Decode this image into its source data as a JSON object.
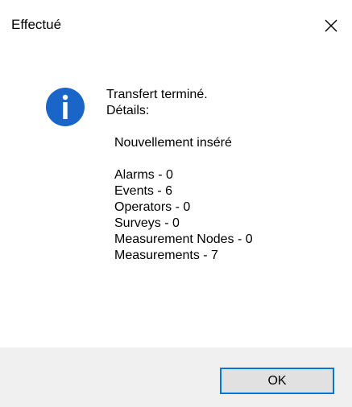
{
  "window": {
    "title": "Effectué",
    "close_icon": "close-icon"
  },
  "icon": {
    "name": "info-icon",
    "color": "#1a66c8"
  },
  "message": {
    "line1": "Transfert terminé.",
    "line2": "Détails:",
    "heading": "Nouvellement inséré",
    "items": [
      "Alarms - 0",
      "Events - 6",
      "Operators - 0",
      "Surveys - 0",
      "Measurement Nodes - 0",
      "Measurements - 7"
    ]
  },
  "footer": {
    "ok_label": "OK"
  },
  "colors": {
    "accent": "#0078d7",
    "footer_bg": "#f0f0f0"
  }
}
